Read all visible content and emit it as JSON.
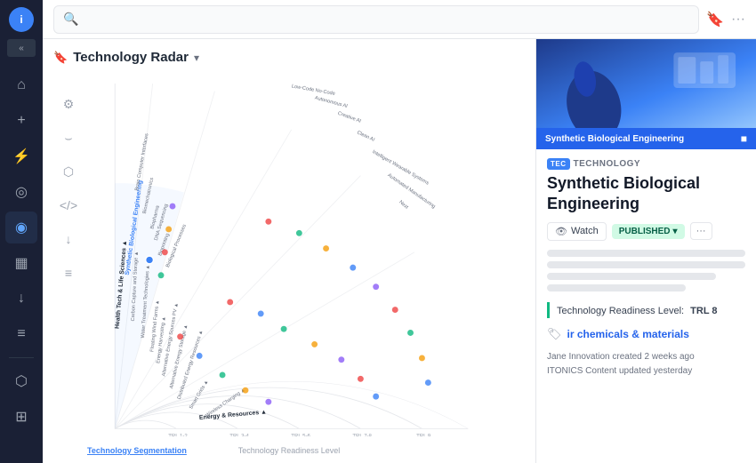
{
  "sidebar": {
    "logo_letter": "i",
    "collapse_icon": "«",
    "items": [
      {
        "name": "home-icon",
        "icon": "⌂",
        "active": false
      },
      {
        "name": "add-icon",
        "icon": "+",
        "active": false
      },
      {
        "name": "lightning-icon",
        "icon": "⚡",
        "active": false
      },
      {
        "name": "explore-icon",
        "icon": "◎",
        "active": false
      },
      {
        "name": "radar-icon",
        "icon": "◉",
        "active": true
      },
      {
        "name": "chart-icon",
        "icon": "▦",
        "active": false
      },
      {
        "name": "download-icon",
        "icon": "↓",
        "active": false
      },
      {
        "name": "list-icon",
        "icon": "≡",
        "active": false
      },
      {
        "name": "network-icon",
        "icon": "⬡",
        "active": false
      },
      {
        "name": "layers-icon",
        "icon": "⊞",
        "active": false
      }
    ]
  },
  "topbar": {
    "search_placeholder": "",
    "bookmark_icon": "🔖",
    "more_icon": "···"
  },
  "radar": {
    "title": "Technology Radar",
    "chevron": "▾",
    "footer_center": "Technology Readiness Level",
    "footer_left": "Technology Segmentation",
    "highlighted_label": "Synthetic Biological Engineering",
    "section_labels": [
      "Health Tech & Life Sciences ▲",
      "Energy & Resources ▲"
    ],
    "arc_labels": [
      "Carbon Capture and Storage ▲",
      "Water Treatment Technologies ▲",
      "Floating Wind Farms ▲",
      "Energy Harvesting ▲",
      "Alternative Energy Sources PV ▲",
      "Alternative Energy Storage ▲",
      "Distributed Energy Resources ▲",
      "Smart Grids ▲",
      "Wireless Charging ▲"
    ]
  },
  "detail_panel": {
    "header_bar_title": "Synthetic Biological Engineering",
    "header_close": "■",
    "tag_badge": "TEC",
    "tag_label": "TECHNOLOGY",
    "main_title": "Synthetic Biological Engineering",
    "watch_label": "Watch",
    "published_label": "PUBLISHED",
    "more_label": "···",
    "trl_label": "Technology Readiness Level:",
    "trl_value": "TRL 8",
    "category_label": "ir chemicals & materials",
    "footer_line1": "Jane Innovation created 2 weeks ago",
    "footer_line2": "ITONICS Content updated yesterday"
  }
}
